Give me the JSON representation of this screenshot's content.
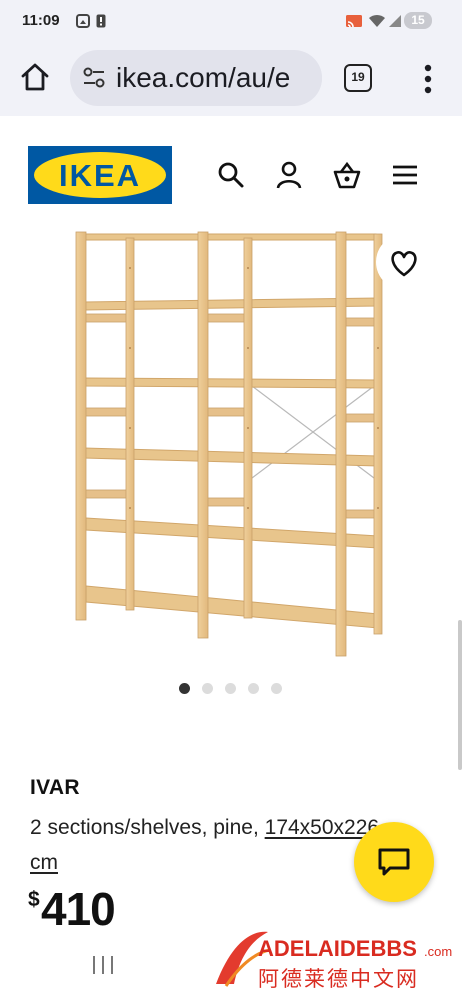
{
  "status_bar": {
    "time": "11:09",
    "battery": "15",
    "icons": [
      "screenshot-icon",
      "alert-icon",
      "cast-icon",
      "wifi-icon",
      "signal-icon"
    ]
  },
  "browser": {
    "url": "ikea.com/au/e",
    "tab_count": "19",
    "icons": [
      "home-icon",
      "site-settings-icon",
      "overflow-menu-icon"
    ]
  },
  "site_header": {
    "logo_text": "IKEA",
    "brand_colors": {
      "blue": "#0058a3",
      "yellow": "#ffda1a"
    },
    "icons": [
      "search-icon",
      "account-icon",
      "basket-icon",
      "hamburger-menu-icon"
    ]
  },
  "gallery": {
    "image_count": 5,
    "active_index": 0,
    "favourite_icon": "heart-icon"
  },
  "product": {
    "name": "IVAR",
    "description_prefix": "2 sections/shelves, pine, ",
    "measurement": "174x50x226",
    "unit": "cm",
    "currency_symbol": "$",
    "price": "410"
  },
  "chat": {
    "icon": "chat-icon"
  },
  "watermark": {
    "brand": "ADELAIDEBBS",
    "suffix": ".com",
    "subtitle": "阿德莱德中文网"
  }
}
